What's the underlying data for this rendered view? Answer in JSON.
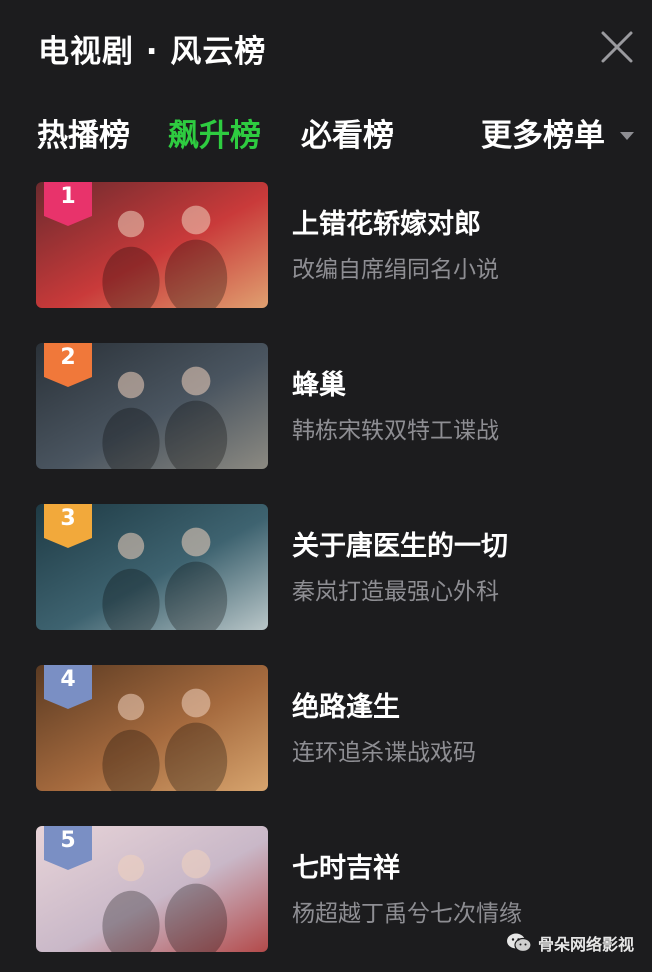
{
  "header": {
    "title": "电视剧 · 风云榜"
  },
  "tabs": [
    {
      "label": "热播榜",
      "active": false
    },
    {
      "label": "飙升榜",
      "active": true
    },
    {
      "label": "必看榜",
      "active": false
    }
  ],
  "more": {
    "label": "更多榜单"
  },
  "items": [
    {
      "rank": "1",
      "title": "上错花轿嫁对郎",
      "desc": "改编自席绢同名小说",
      "badge_color": "#e8336b",
      "thumb_colors": [
        "#6b2a2e",
        "#c93a3a",
        "#e0a070"
      ]
    },
    {
      "rank": "2",
      "title": "蜂巢",
      "desc": "韩栋宋轶双特工谍战",
      "badge_color": "#f0783a",
      "thumb_colors": [
        "#2a3138",
        "#4a5560",
        "#8c8a82"
      ]
    },
    {
      "rank": "3",
      "title": "关于唐医生的一切",
      "desc": "秦岚打造最强心外科",
      "badge_color": "#f2a93b",
      "thumb_colors": [
        "#1e3a44",
        "#3e6370",
        "#b9c6c8"
      ]
    },
    {
      "rank": "4",
      "title": "绝路逢生",
      "desc": "连环追杀谍战戏码",
      "badge_color": "#7a8fc4",
      "thumb_colors": [
        "#5a3a22",
        "#a56a3e",
        "#d7a46e"
      ]
    },
    {
      "rank": "5",
      "title": "七时吉祥",
      "desc": "杨超越丁禹兮七次情缘",
      "badge_color": "#7a8fc4",
      "thumb_colors": [
        "#e8d4d8",
        "#c9b8c8",
        "#b34a4a"
      ]
    }
  ],
  "watermark": {
    "text": "骨朵网络影视"
  },
  "icons": {
    "close": "close-icon",
    "more": "chevron-down-icon",
    "watermark": "wechat-icon"
  }
}
